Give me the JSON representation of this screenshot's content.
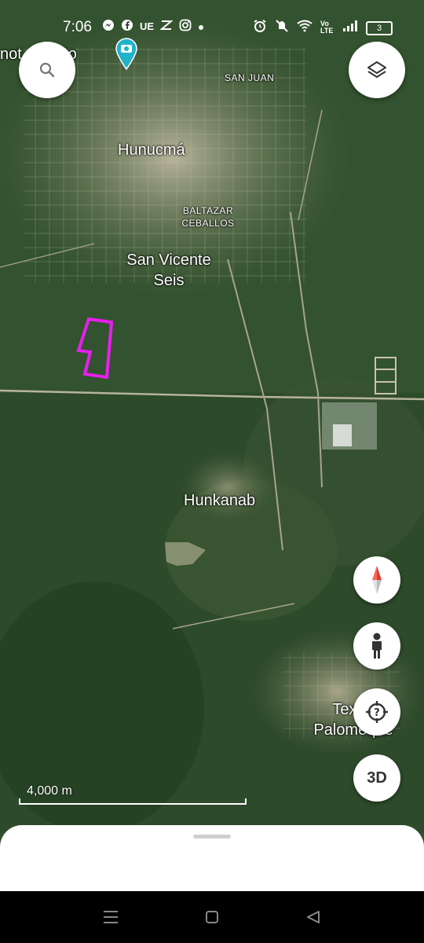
{
  "status_bar": {
    "time": "7:06",
    "battery": "3",
    "icons_left": [
      "messenger-icon",
      "facebook-icon",
      "ue-icon",
      "capcut-icon",
      "instagram-icon",
      "dot-icon"
    ],
    "icons_right": [
      "alarm-icon",
      "mute-icon",
      "wifi-icon",
      "volte-icon",
      "signal-icon",
      "battery-icon"
    ],
    "ue_text": "UE",
    "volte_text": "Vo LTE"
  },
  "map": {
    "places": [
      {
        "name": "notocito_partial",
        "text": "not     ocito"
      },
      {
        "name": "san-juan",
        "text": "SAN JUAN"
      },
      {
        "name": "hunucma",
        "text": "Hunucmá"
      },
      {
        "name": "baltazar-ceballos",
        "text": "BALTAZAR CEBALLOS"
      },
      {
        "name": "san-vicente-seis",
        "text": "San Vicente Seis"
      },
      {
        "name": "hunkanab",
        "text": "Hunkanab"
      },
      {
        "name": "texan-palomeque",
        "text": "Texán Palomeque"
      }
    ],
    "scale_label": "4,000 m",
    "colors": {
      "forest": "#2f4f2e",
      "outline": "#e81ef0",
      "pin": "#20b2c9"
    }
  },
  "controls": {
    "threed_label": "3D"
  }
}
